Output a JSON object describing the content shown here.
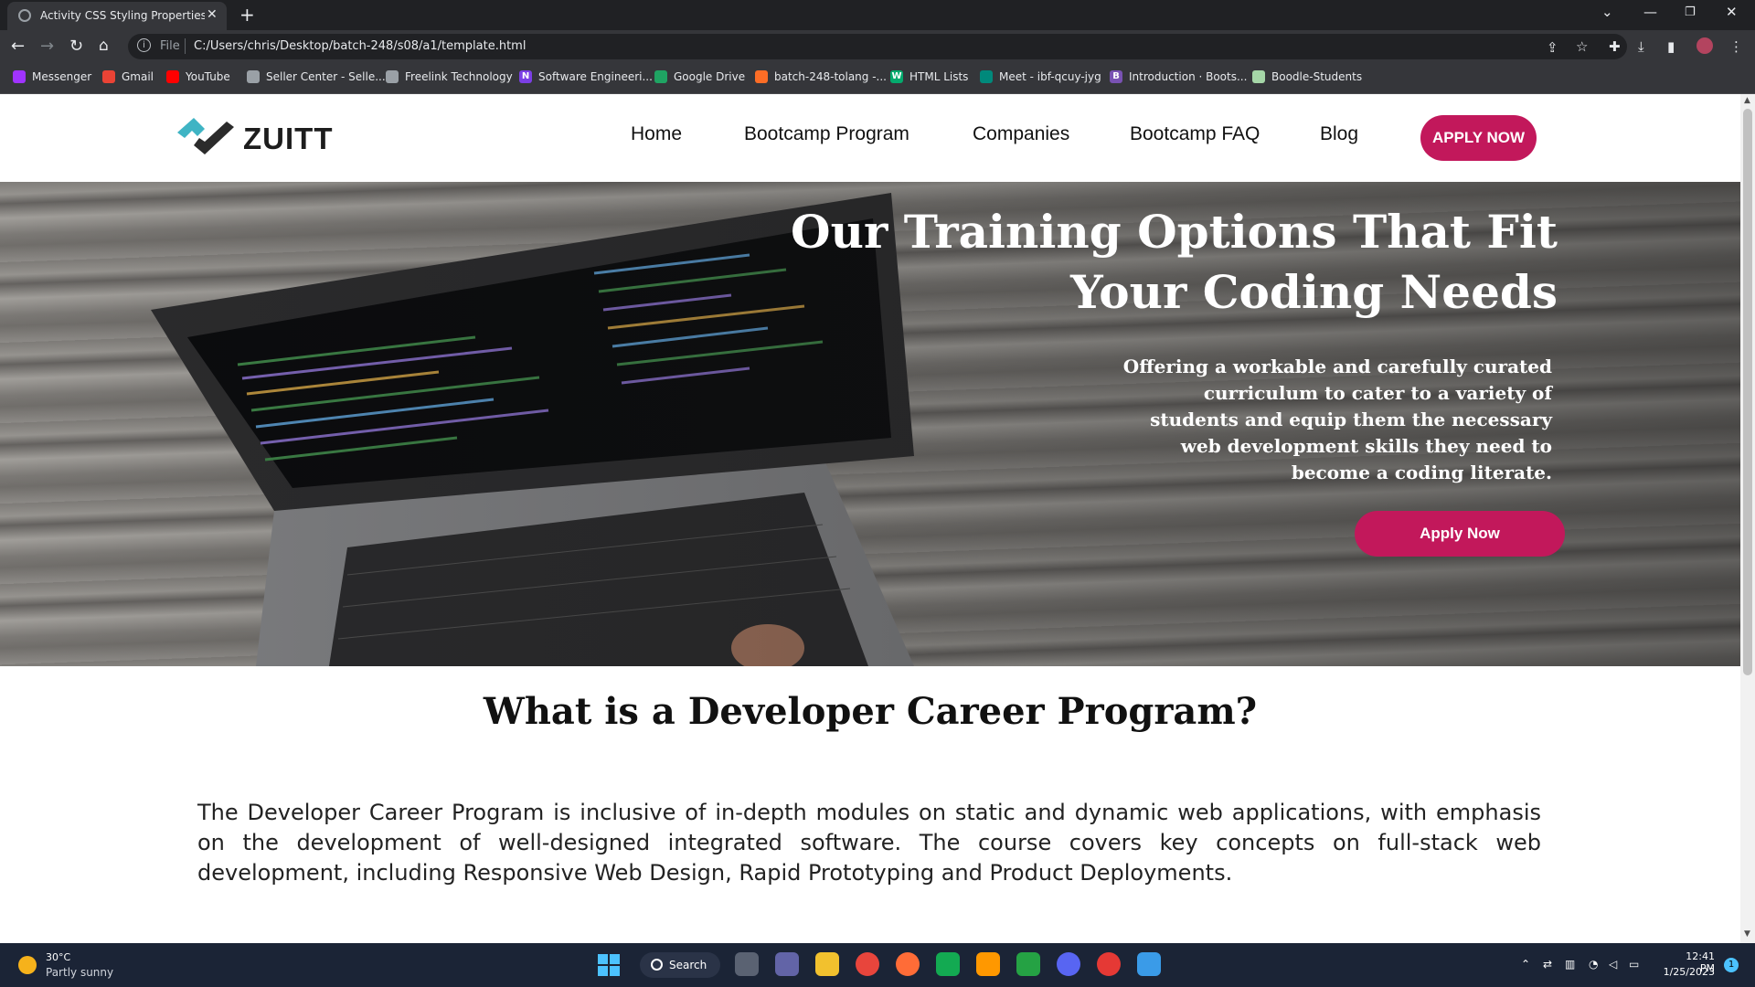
{
  "browser": {
    "tab_title": "Activity CSS Styling Properties an",
    "url_scheme": "File",
    "url": "C:/Users/chris/Desktop/batch-248/s08/a1/template.html",
    "bookmarks": [
      {
        "label": "Messenger",
        "color": "#a033ff"
      },
      {
        "label": "Gmail",
        "color": "#ea4335"
      },
      {
        "label": "YouTube",
        "color": "#ff0000"
      },
      {
        "label": "Seller Center - Selle...",
        "color": "#9aa0a6"
      },
      {
        "label": "Freelink Technology",
        "color": "#9aa0a6"
      },
      {
        "label": "Software Engineeri...",
        "color": "#7b3fe4"
      },
      {
        "label": "Google Drive",
        "color": "#1fa463"
      },
      {
        "label": "batch-248-tolang -...",
        "color": "#fc6d26"
      },
      {
        "label": "HTML Lists",
        "color": "#04aa6d"
      },
      {
        "label": "Meet - ibf-qcuy-jyg",
        "color": "#00897b"
      },
      {
        "label": "Introduction · Boots...",
        "color": "#7952b3"
      },
      {
        "label": "Boodle-Students",
        "color": "#a5d6a7"
      }
    ]
  },
  "site": {
    "logo_text": "ZUITT",
    "nav": [
      "Home",
      "Bootcamp Program",
      "Companies",
      "Bootcamp FAQ",
      "Blog"
    ],
    "apply_nav_label": "APPLY NOW",
    "accent_color": "#c2185b"
  },
  "hero": {
    "title": "Our Training Options That Fit Your Coding Needs",
    "text": "Offering a workable and carefully curated curriculum to cater to a variety of students and equip them the necessary web development skills they need to become a coding literate.",
    "button_label": "Apply Now"
  },
  "section": {
    "title": "What is a Developer Career Program?",
    "body": "The Developer Career Program is inclusive of in-depth modules on static and dynamic web applications, with emphasis on the development of well-designed integrated software. The course covers key concepts on full-stack web development, including Responsive Web Design, Rapid Prototyping and Product Deployments."
  },
  "taskbar": {
    "weather_temp": "30°C",
    "weather_condition": "Partly sunny",
    "search_label": "Search",
    "time": "12:41 PM",
    "date": "1/25/2023",
    "notification_count": "1"
  }
}
